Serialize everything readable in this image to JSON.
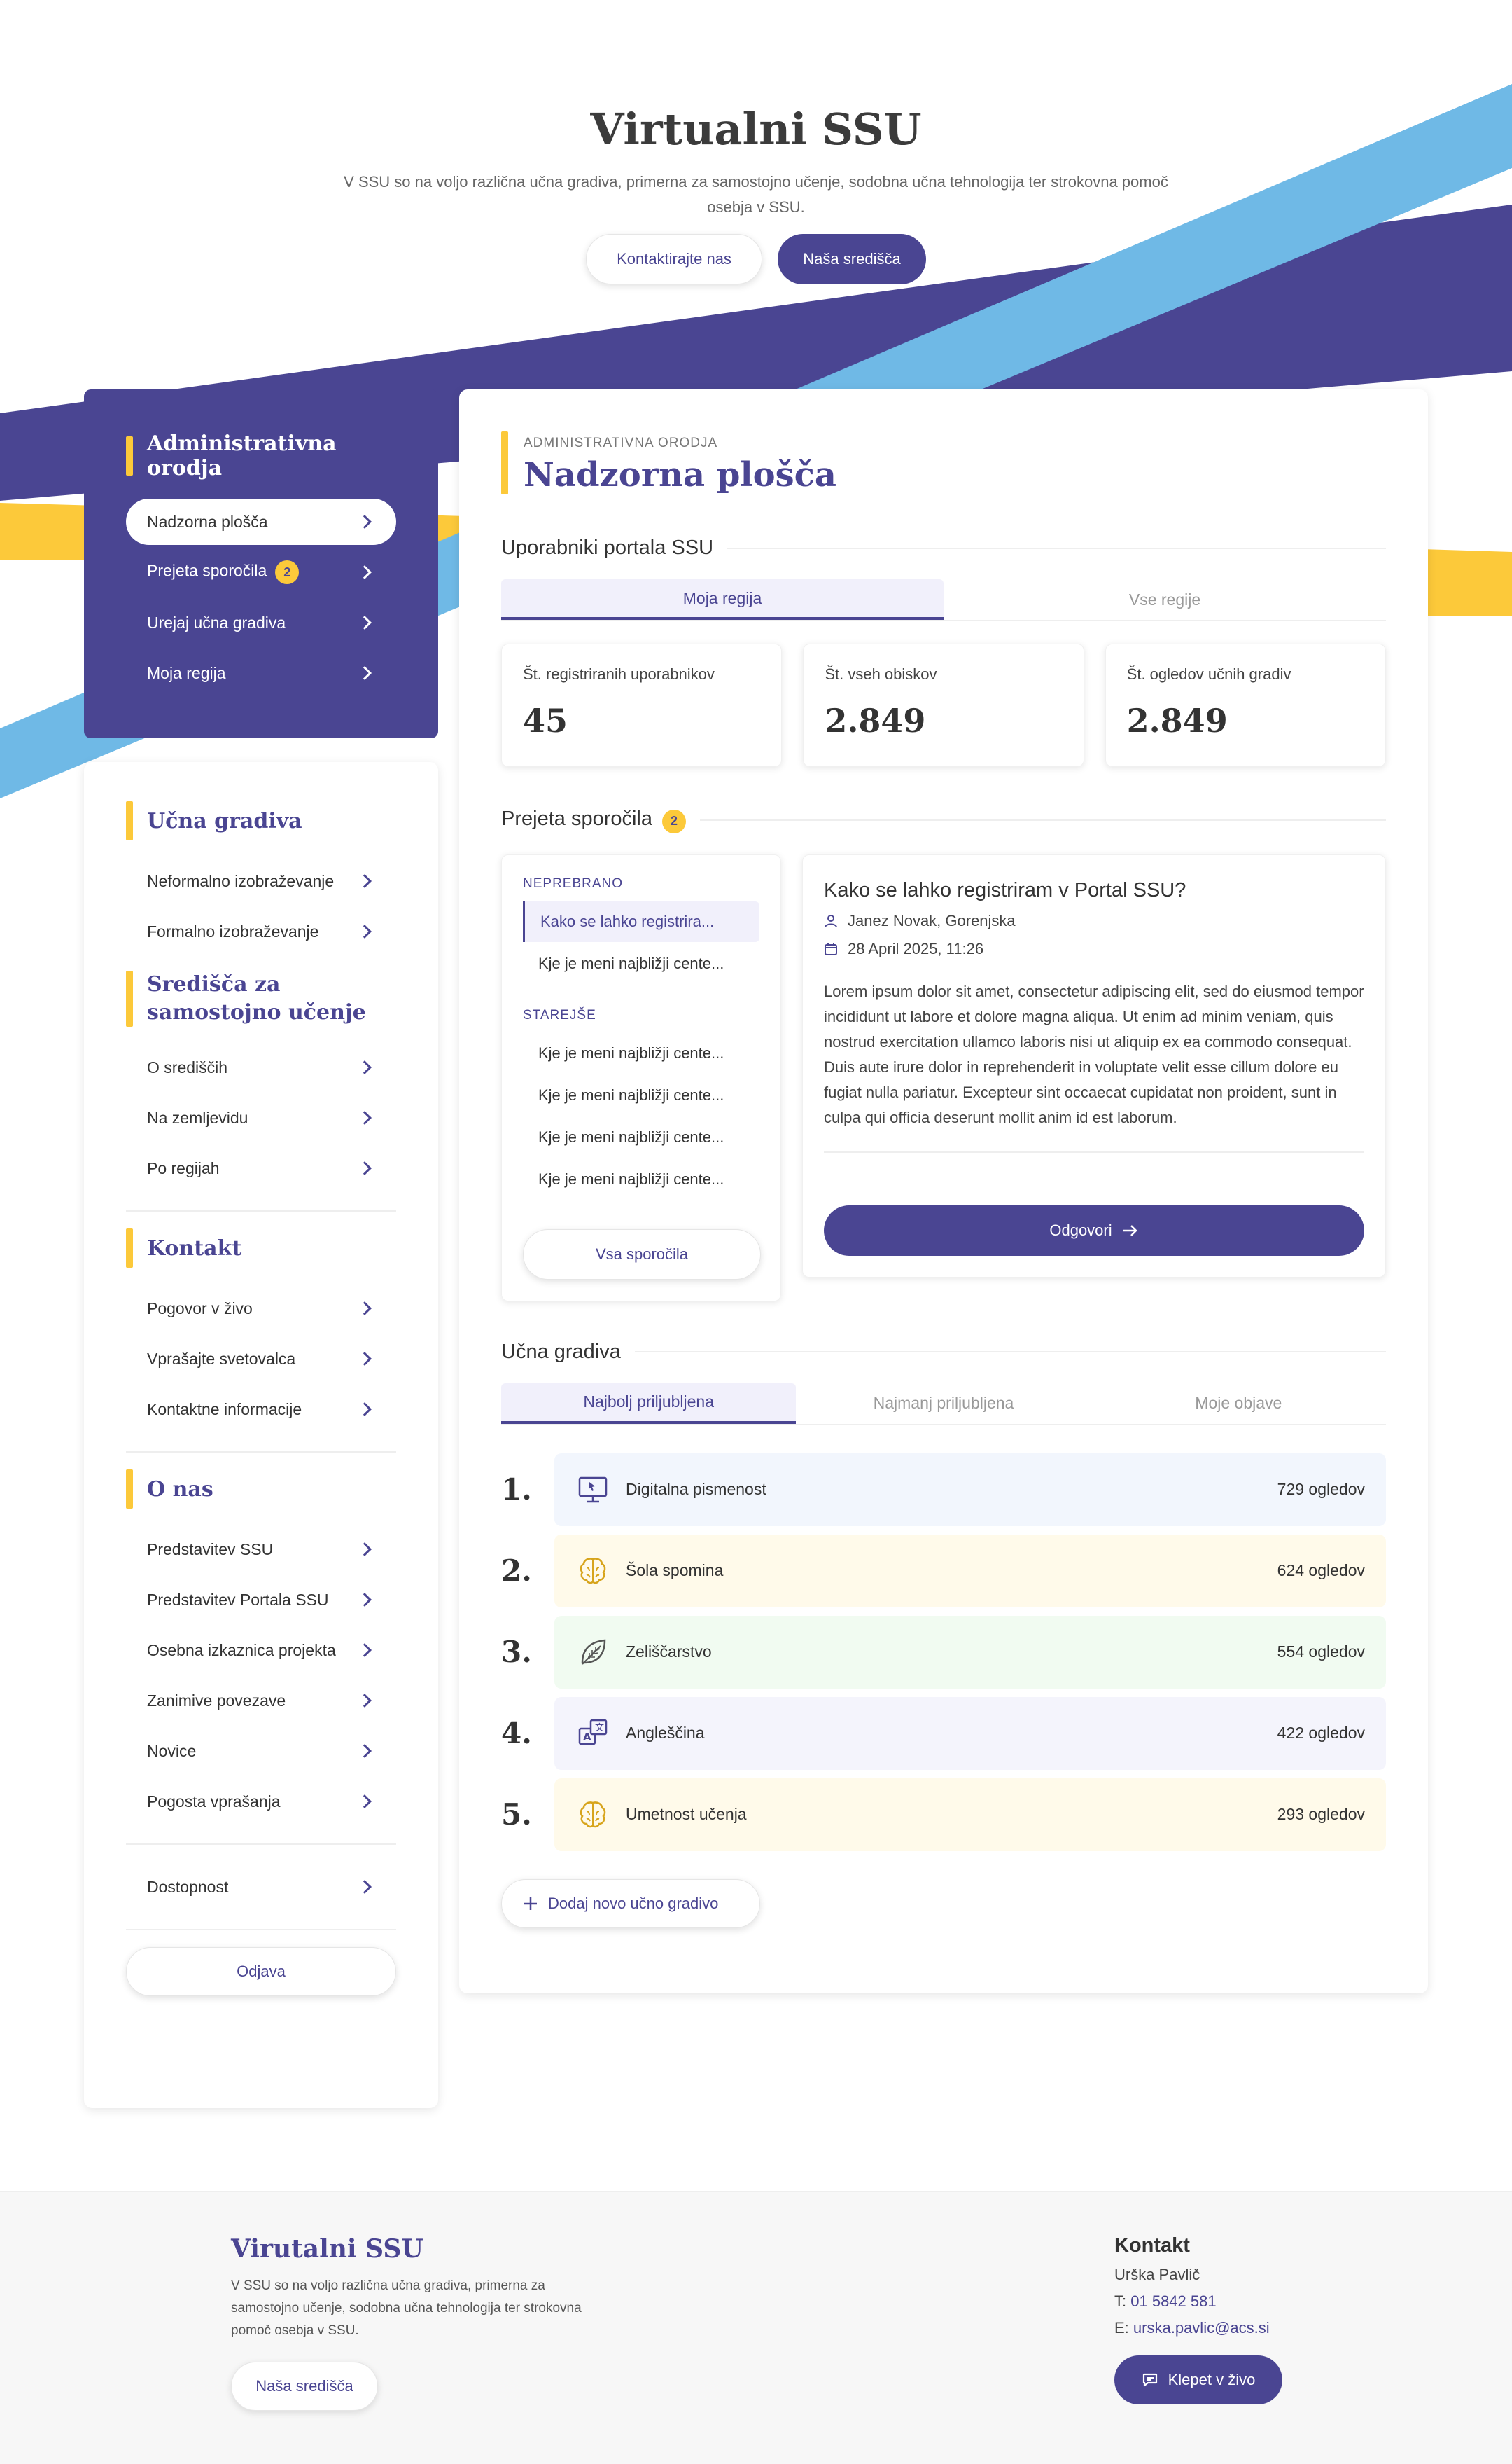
{
  "hero": {
    "title": "Virtualni SSU",
    "description": "V SSU so na voljo različna učna gradiva, primerna za samostojno učenje, sodobna učna tehnologija ter strokovna pomoč osebja v SSU.",
    "contact_label": "Kontaktirajte nas",
    "centers_label": "Naša središča"
  },
  "sidebar": {
    "admin": {
      "title": "Administrativna orodja",
      "items": [
        {
          "label": "Nadzorna plošča",
          "active": true
        },
        {
          "label": "Prejeta sporočila",
          "badge": "2"
        },
        {
          "label": "Urejaj učna gradiva"
        },
        {
          "label": "Moja regija"
        }
      ]
    },
    "groups": [
      {
        "title": "Učna gradiva",
        "items": [
          "Neformalno izobraževanje",
          "Formalno izobraževanje"
        ]
      },
      {
        "title": "Središča za samostojno učenje",
        "items": [
          "O središčih",
          "Na zemljevidu",
          "Po regijah"
        ]
      },
      {
        "title": "Kontakt",
        "items": [
          "Pogovor v živo",
          "Vprašajte svetovalca",
          "Kontaktne informacije"
        ]
      },
      {
        "title": "O nas",
        "items": [
          "Predstavitev SSU",
          "Predstavitev Portala SSU",
          "Osebna izkaznica projekta",
          "Zanimive povezave",
          "Novice",
          "Pogosta vprašanja"
        ]
      }
    ],
    "accessibility": "Dostopnost",
    "logout": "Odjava"
  },
  "main": {
    "kicker": "ADMINISTRATIVNA ORODJA",
    "title": "Nadzorna plošča",
    "users": {
      "title": "Uporabniki portala SSU",
      "tabs": [
        "Moja regija",
        "Vse regije"
      ],
      "stats": [
        {
          "label": "Št. registriranih uporabnikov",
          "value": "45"
        },
        {
          "label": "Št. vseh obiskov",
          "value": "2.849"
        },
        {
          "label": "Št. ogledov učnih gradiv",
          "value": "2.849"
        }
      ]
    },
    "messages": {
      "title": "Prejeta sporočila",
      "badge": "2",
      "unread_label": "NEPREBRANO",
      "unread": [
        "Kako se lahko registrira..."
      ],
      "older_label": "STAREJŠE",
      "older": [
        "Kje je meni najbližji cente...",
        "Kje je meni najbližji cente...",
        "Kje je meni najbližji cente...",
        "Kje je meni najbližji cente...",
        "Kje je meni najbližji cente..."
      ],
      "all_label": "Vsa sporočila",
      "detail": {
        "subject": "Kako se lahko registriram v Portal SSU?",
        "author": "Janez Novak, Gorenjska",
        "date": "28 April 2025, 11:26",
        "body": "Lorem ipsum dolor sit amet, consectetur adipiscing elit, sed do eiusmod tempor incididunt ut labore et dolore magna aliqua. Ut enim ad minim veniam, quis nostrud exercitation ullamco laboris nisi ut aliquip ex ea commodo consequat. Duis aute irure dolor in reprehenderit in voluptate velit esse cillum dolore eu fugiat nulla pariatur. Excepteur sint occaecat cupidatat non proident, sunt in culpa qui officia deserunt mollit anim id est laborum.",
        "reply_label": "Odgovori"
      }
    },
    "materials": {
      "title": "Učna gradiva",
      "tabs": [
        "Najbolj priljubljena",
        "Najmanj priljubljena",
        "Moje objave"
      ],
      "items": [
        {
          "rank": "1.",
          "name": "Digitalna pismenost",
          "views": "729 ogledov",
          "icon": "monitor-icon",
          "bg": "#f2f6fd"
        },
        {
          "rank": "2.",
          "name": "Šola spomina",
          "views": "624 ogledov",
          "icon": "brain-icon",
          "bg": "#fffaea"
        },
        {
          "rank": "3.",
          "name": "Zeliščarstvo",
          "views": "554 ogledov",
          "icon": "leaf-icon",
          "bg": "#f1fbf1"
        },
        {
          "rank": "4.",
          "name": "Angleščina",
          "views": "422 ogledov",
          "icon": "translate-icon",
          "bg": "#f4f4fc"
        },
        {
          "rank": "5.",
          "name": "Umetnost učenja",
          "views": "293 ogledov",
          "icon": "brain-icon",
          "bg": "#fffaea"
        }
      ],
      "add_label": "Dodaj novo učno gradivo"
    }
  },
  "footer": {
    "title": "Virutalni SSU",
    "description": "V SSU so na voljo različna učna gradiva, primerna za samostojno učenje, sodobna učna tehnologija ter strokovna pomoč osebja v SSU.",
    "centers_label": "Naša središča",
    "contact": {
      "title": "Kontakt",
      "name": "Urška Pavlič",
      "phone_prefix": "T:",
      "phone": "01 5842 581",
      "email_prefix": "E:",
      "email": "urska.pavlic@acs.si",
      "chat_label": "Klepet v živo"
    }
  },
  "colors": {
    "primary": "#4a4592",
    "accent": "#fcc93a",
    "sky": "#6fb9e6"
  }
}
